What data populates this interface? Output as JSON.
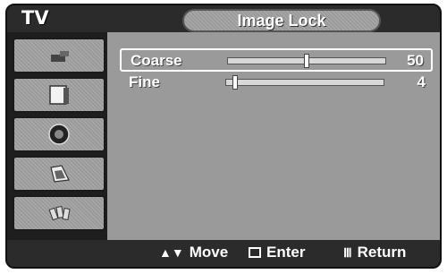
{
  "header": {
    "tv_label": "TV",
    "title": "Image Lock"
  },
  "sidebar": {
    "items": [
      {
        "icon": "antenna-icon"
      },
      {
        "icon": "picture-icon"
      },
      {
        "icon": "sound-icon"
      },
      {
        "icon": "channel-icon"
      },
      {
        "icon": "setup-icon"
      }
    ]
  },
  "settings": {
    "rows": [
      {
        "label": "Coarse",
        "value": "50",
        "level": 0.5,
        "selected": true
      },
      {
        "label": "Fine",
        "value": "4",
        "level": 0.04,
        "selected": false
      }
    ]
  },
  "footer": {
    "move_label": "Move",
    "enter_label": "Enter",
    "return_label": "Return"
  }
}
